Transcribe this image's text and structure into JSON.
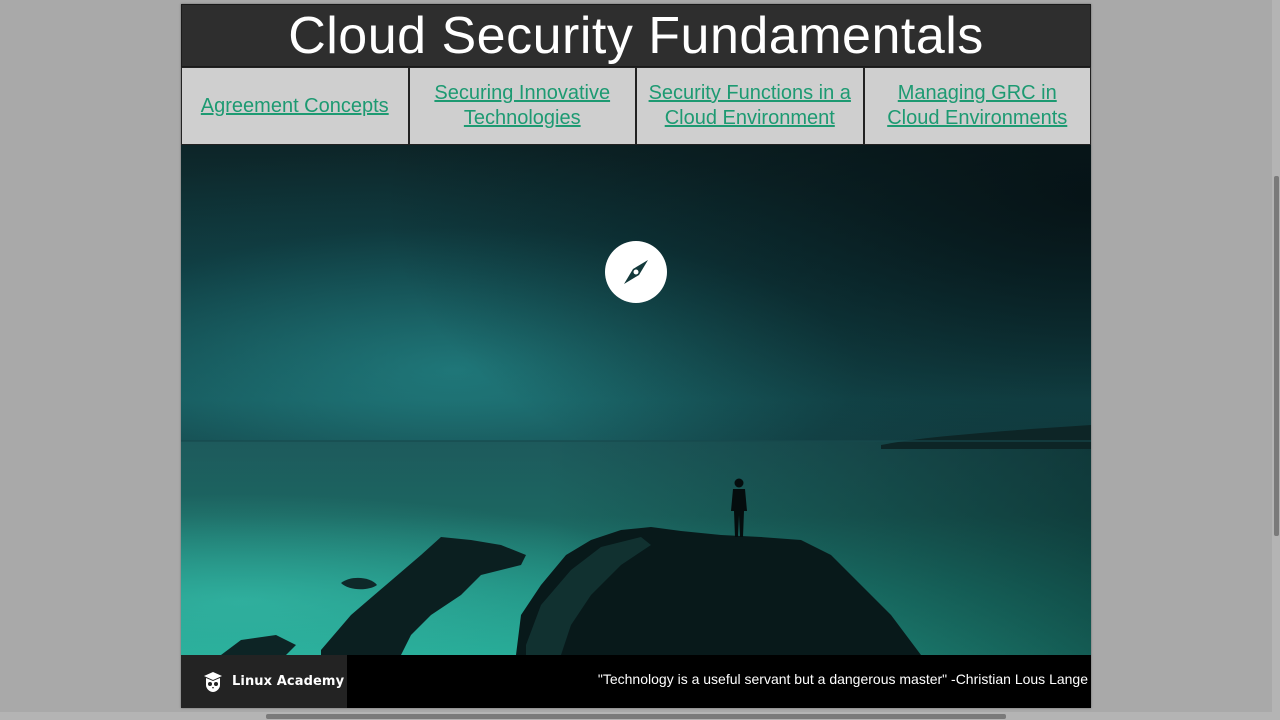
{
  "slide": {
    "title": "Cloud Security Fundamentals",
    "nav_links": [
      {
        "label": "Agreement Concepts"
      },
      {
        "label": "Securing Innovative Technologies"
      },
      {
        "label": "Security Functions in a Cloud Environment"
      },
      {
        "label": "Managing GRC in Cloud Environments"
      }
    ],
    "hero": {
      "icon": "compass-icon",
      "image": "person standing on rocky cliff overlooking teal sea"
    },
    "footer": {
      "brand_name": "Linux Academy",
      "brand_icon": "linux-academy-owl-icon",
      "quote": "\"Technology is a useful servant but a dangerous master\" -Christian Lous Lange"
    }
  },
  "colors": {
    "link": "#1d9a72",
    "title_bar": "#2e2e2e",
    "nav_cell": "#cfcfcf",
    "hero_teal": "#1f8c7e",
    "page_background": "#a9a9a9"
  }
}
